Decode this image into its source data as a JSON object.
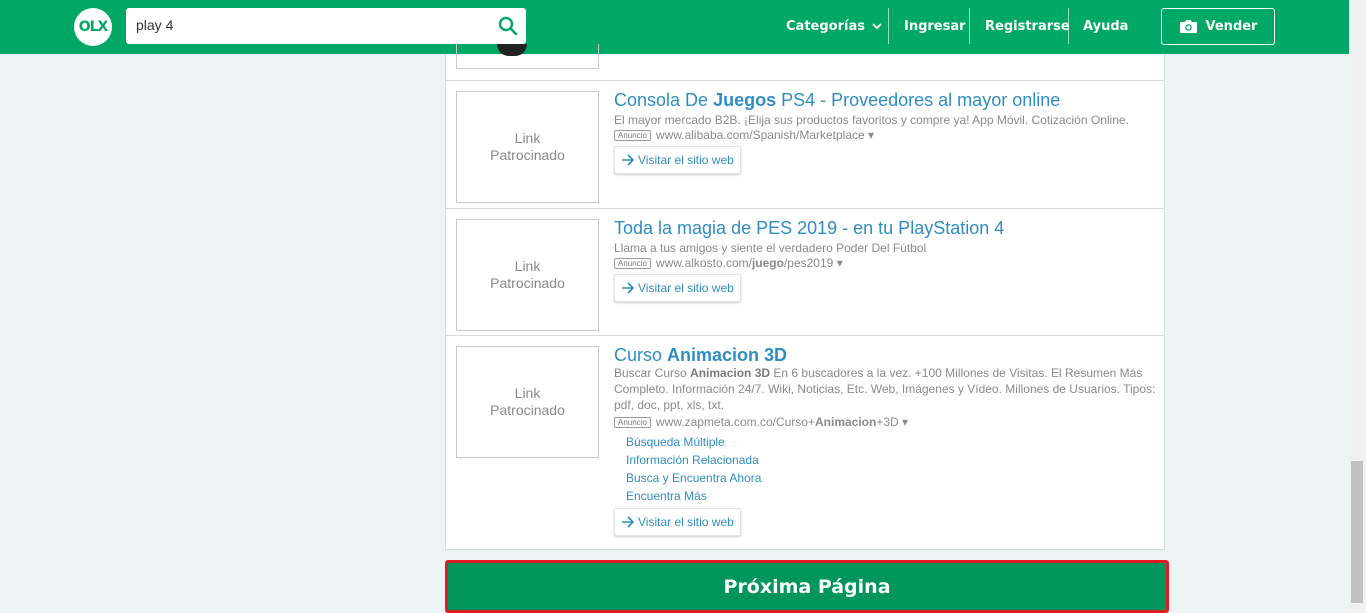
{
  "header": {
    "logo_text": "OLX",
    "search": {
      "value": "play 4"
    },
    "nav": {
      "categorias": "Categorías",
      "ingresar": "Ingresar",
      "registrarse": "Registrarse",
      "ayuda": "Ayuda"
    },
    "vender": "Vender"
  },
  "colors": {
    "brand": "#00a866",
    "link": "#2f8dc4",
    "next_bg": "#00955a",
    "next_border": "#e01b24"
  },
  "ads": [
    {
      "placeholder": [
        "Link",
        "Patrocinado"
      ],
      "title_pre": "Consola De ",
      "title_bold": "Juegos",
      "title_post": " PS4 - Proveedores al mayor online",
      "desc": "El mayor mercado B2B. ¡Elija sus productos favoritos y compre ya! App Móvil. Cotización Online.",
      "badge": "Anuncio",
      "url": "www.alibaba.com/Spanish/Marketplace",
      "visit": "Visitar el sitio web"
    },
    {
      "placeholder": [
        "Link",
        "Patrocinado"
      ],
      "title_pre": "Toda la magia de PES 2019 - en tu PlayStation 4",
      "title_bold": "",
      "title_post": "",
      "desc": "Llama a tus amigos y siente el verdadero Poder Del Fútbol",
      "badge": "Anuncio",
      "url_pre": "www.alkosto.com/",
      "url_bold": "juego",
      "url_post": "/pes2019",
      "visit": "Visitar el sitio web"
    },
    {
      "placeholder": [
        "Link",
        "Patrocinado"
      ],
      "title_pre": "Curso ",
      "title_bold": "Animacion 3D",
      "title_post": "",
      "desc_pre": "Buscar Curso ",
      "desc_bold": "Animacion 3D",
      "desc_post": " En 6 buscadores a la vez. +100 Millones de Visitas. El Resumen Más Completo. Información 24/7. Wiki, Noticias, Etc. Web, Imágenes y Vídeo. Millones de Usuarios. Tipos: pdf, doc, ppt, xls, txt.",
      "badge": "Anuncio",
      "url_pre": "www.zapmeta.com.co/Curso+",
      "url_bold": "Animacion",
      "url_post": "+3D",
      "sitelinks": [
        "Búsqueda Múltiple",
        "Información Relacionada",
        "Busca y Encuentra Ahora",
        "Encuentra Más"
      ],
      "visit": "Visitar el sitio web"
    }
  ],
  "next_page": "Próxima Página"
}
